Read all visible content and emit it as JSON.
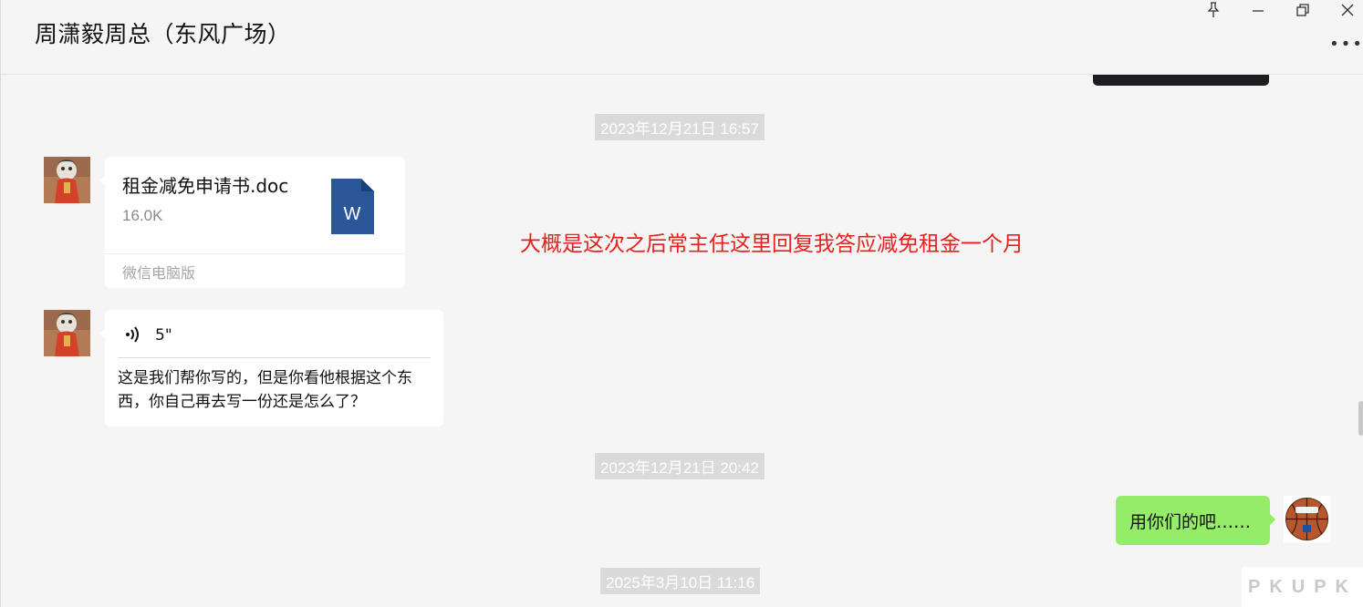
{
  "window": {
    "title": "周潇毅周总（东风广场）",
    "more_label": "•••"
  },
  "messages": {
    "timestamp_1": "2023年12月21日 16:57",
    "file": {
      "name": "租金减免申请书.doc",
      "size": "16.0K",
      "type_letter": "W",
      "source": "微信电脑版"
    },
    "annotation": "大概是这次之后常主任这里回复我答应减免租金一个月",
    "voice": {
      "duration": "5\"",
      "transcript": "这是我们帮你写的，但是你看他根据这个东西，你自己再去写一份还是怎么了？"
    },
    "timestamp_2": "2023年12月21日 20:42",
    "reply": "用你们的吧……",
    "timestamp_3": "2025年3月10日 11:16"
  },
  "watermark": "PKUPK",
  "colors": {
    "background": "#f5f5f5",
    "sent_bubble": "#95ec69",
    "received_bubble": "#ffffff",
    "annotation_red": "#e8201d",
    "doc_icon_blue": "#2b579a"
  },
  "icons": {
    "pin": "pin-icon",
    "minimize": "minimize-icon",
    "restore": "restore-icon",
    "close": "close-icon",
    "more": "more-icon",
    "voice": "voice-icon",
    "doc": "word-doc-icon"
  }
}
